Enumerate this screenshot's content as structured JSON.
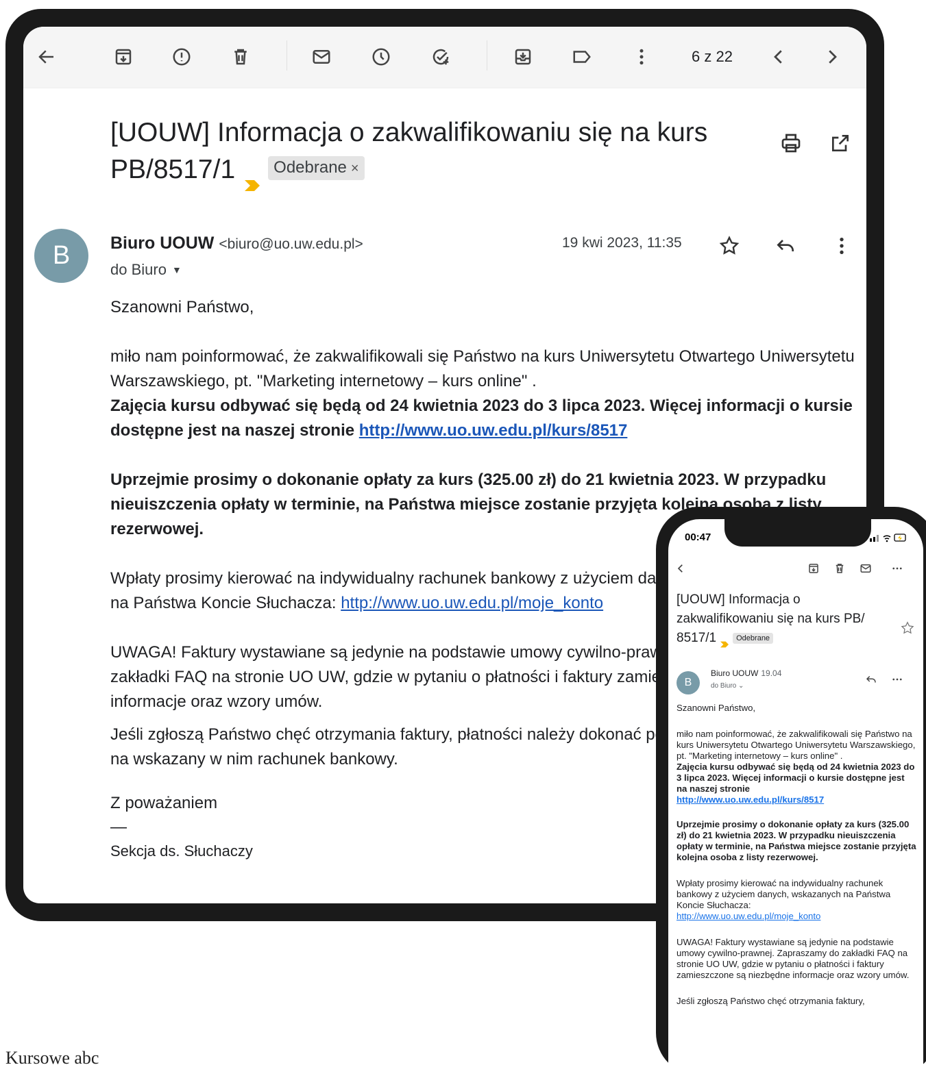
{
  "toolbar": {
    "count": "6 z 22"
  },
  "subject": {
    "text": "[UOUW] Informacja o zakwalifikowaniu się na kurs PB/8517/1",
    "label": "Odebrane",
    "label_close": "×"
  },
  "message": {
    "avatar_letter": "B",
    "sender_name": "Biuro UOUW",
    "sender_email": "<biuro@uo.uw.edu.pl>",
    "recipient": "do Biuro",
    "date": "19 kwi 2023, 11:35"
  },
  "body": {
    "greeting": "Szanowni Państwo,",
    "p1": "miło nam poinformować, że zakwalifikowali się Państwo na kurs Uniwersytetu Otwartego Uniwersytetu Warszawskiego, pt.  \"Marketing internetowy – kurs online\" .",
    "p1_bold": "Zajęcia kursu odbywać się będą od 24 kwietnia 2023 do 3 lipca 2023. Więcej informacji o kursie dostępne jest na naszej stronie ",
    "course_link": "http://www.uo.uw.edu.pl/kurs/8517",
    "p2_bold": "Uprzejmie prosimy o dokonanie opłaty za kurs (325.00 zł) do 21 kwietnia 2023. W przypadku nieuiszczenia opłaty w terminie, na Państwa miejsce zostanie przyjęta kolejna osoba z listy rezerwowej.",
    "p3_a": "Wpłaty prosimy kierować na indywidualny rachunek bankowy z użyciem danych, wskazanych",
    "p3_b": "na Państwa Koncie Słuchacza: ",
    "account_link": "http://www.uo.uw.edu.pl/moje_konto",
    "p4": "UWAGA! Faktury wystawiane są jedynie na podstawie umowy cywilno-prawnej. Zapraszamy do zakładki FAQ na stronie UO UW, gdzie w pytaniu o płatności i faktury zamieszczone są niezbędne informacje oraz wzory umów.",
    "p5": "Jeśli zgłoszą Państwo chęć otrzymania faktury, płatności należy dokonać po otrzymaniu dokumentu na wskazany w nim rachunek bankowy.",
    "regards": "Z poważaniem",
    "dash": "—",
    "section": "Sekcja ds. Słuchaczy"
  },
  "phone": {
    "time": "00:47",
    "subject": "[UOUW] Informacja o zakwalifikowaniu się na kurs PB/ 8517/1",
    "label": "Odebrane",
    "avatar_letter": "B",
    "sender": "Biuro UOUW",
    "date": "19.04",
    "recipient": "do Biuro ⌄",
    "greeting": "Szanowni Państwo,",
    "p1": "miło nam poinformować, że zakwalifikowali się Państwo na kurs Uniwersytetu Otwartego Uniwersytetu Warszawskiego, pt.  \"Marketing internetowy – kurs online\" .",
    "p1_bold": "Zajęcia kursu odbywać się będą od 24 kwietnia 2023 do 3 lipca 2023. Więcej informacji o kursie dostępne jest na naszej stronie",
    "course_link": "http://www.uo.uw.edu.pl/kurs/8517",
    "p2_bold": "Uprzejmie prosimy o dokonanie opłaty za kurs (325.00 zł) do 21 kwietnia 2023. W przypadku nieuiszczenia opłaty w terminie, na Państwa miejsce zostanie przyjęta kolejna osoba z listy rezerwowej.",
    "p3": "Wpłaty prosimy kierować na indywidualny rachunek bankowy z użyciem danych, wskazanych na Państwa Koncie Słuchacza:",
    "account_link": "http://www.uo.uw.edu.pl/moje_konto",
    "p4": "UWAGA! Faktury wystawiane są jedynie na podstawie umowy cywilno-prawnej. Zapraszamy do zakładki FAQ na stronie UO UW, gdzie w pytaniu o płatności i faktury zamieszczone są niezbędne informacje oraz wzory umów.",
    "p5": "Jeśli zgłoszą Państwo chęć otrzymania faktury,"
  },
  "caption": "Kursowe abc",
  "colors": {
    "avatar": "#789ba8",
    "link": "#1a56b8",
    "importance": "#f5b400"
  }
}
